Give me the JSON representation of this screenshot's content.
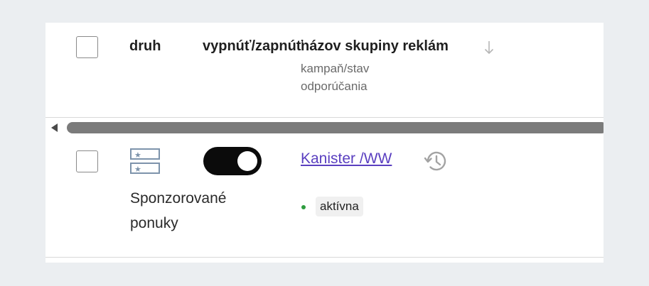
{
  "header": {
    "col_type": "druh",
    "col_toggle": "vypnúť/zapnúť",
    "col_name": "názov skupiny reklám",
    "col_name_sub1": "kampaň/stav",
    "col_name_sub2": "odporúčania"
  },
  "row": {
    "type_label": "Sponzorované ponuky",
    "toggle_on": true,
    "ad_group_name": "Kanister /WW",
    "status": "aktívna"
  },
  "icons": {
    "sort": "arrow-down-icon",
    "ad_type": "sponsored-offers-icon",
    "history": "history-icon"
  },
  "colors": {
    "link": "#5a3fc0",
    "status_active": "#2e9c3e",
    "toggle_bg": "#0b0b0b"
  }
}
